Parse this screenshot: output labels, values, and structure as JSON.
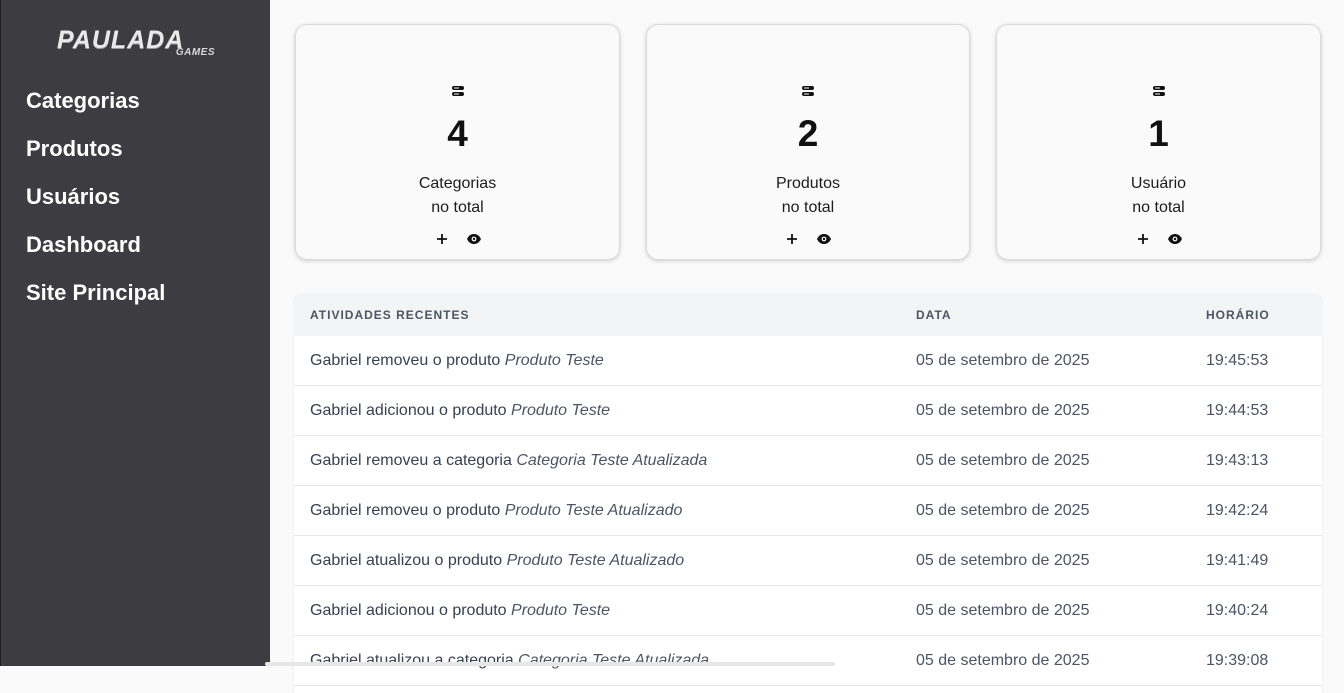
{
  "sidebar": {
    "logo": {
      "main": "PAULADA",
      "sub": "GAMES"
    },
    "items": [
      {
        "label": "Categorias"
      },
      {
        "label": "Produtos"
      },
      {
        "label": "Usuários"
      },
      {
        "label": "Dashboard"
      },
      {
        "label": "Site Principal"
      }
    ]
  },
  "cards": [
    {
      "icon": "server-icon",
      "count": "4",
      "label": "Categorias",
      "sub": "no total"
    },
    {
      "icon": "server-icon",
      "count": "2",
      "label": "Produtos",
      "sub": "no total"
    },
    {
      "icon": "server-icon",
      "count": "1",
      "label": "Usuário",
      "sub": "no total"
    }
  ],
  "activities": {
    "headers": {
      "activity": "ATIVIDADES RECENTES",
      "date": "DATA",
      "time": "HORÁRIO"
    },
    "rows": [
      {
        "text": "Gabriel removeu o produto",
        "item": "Produto Teste",
        "date": "05 de setembro de 2025",
        "time": "19:45:53"
      },
      {
        "text": "Gabriel adicionou o produto",
        "item": "Produto Teste",
        "date": "05 de setembro de 2025",
        "time": "19:44:53"
      },
      {
        "text": "Gabriel removeu a categoria",
        "item": "Categoria Teste Atualizada",
        "date": "05 de setembro de 2025",
        "time": "19:43:13"
      },
      {
        "text": "Gabriel removeu o produto",
        "item": "Produto Teste Atualizado",
        "date": "05 de setembro de 2025",
        "time": "19:42:24"
      },
      {
        "text": "Gabriel atualizou o produto",
        "item": "Produto Teste Atualizado",
        "date": "05 de setembro de 2025",
        "time": "19:41:49"
      },
      {
        "text": "Gabriel adicionou o produto",
        "item": "Produto Teste",
        "date": "05 de setembro de 2025",
        "time": "19:40:24"
      },
      {
        "text": "Gabriel atualizou a categoria",
        "item": "Categoria Teste Atualizada",
        "date": "05 de setembro de 2025",
        "time": "19:39:08"
      }
    ]
  }
}
